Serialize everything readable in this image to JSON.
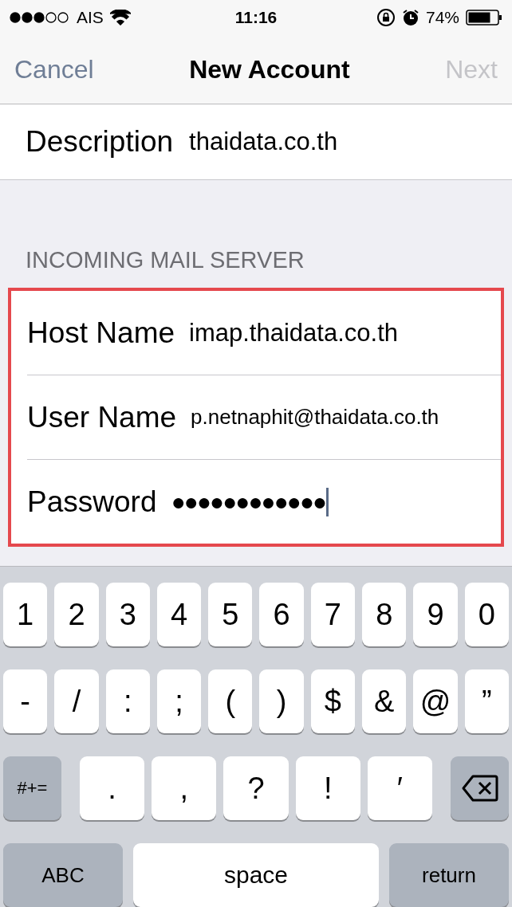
{
  "status_bar": {
    "carrier": "AIS",
    "time": "11:16",
    "battery": "74%"
  },
  "nav": {
    "cancel": "Cancel",
    "title": "New Account",
    "next": {
      "label": "Next",
      "disabled": true
    }
  },
  "description": {
    "label": "Description",
    "value": "thaidata.co.th"
  },
  "incoming": {
    "header": "INCOMING MAIL SERVER",
    "highlighted": true,
    "fields": [
      {
        "label": "Host Name",
        "value": "imap.thaidata.co.th",
        "kind": "text"
      },
      {
        "label": "User Name",
        "value": "p.netnaphit@thaidata.co.th",
        "kind": "text"
      },
      {
        "label": "Password",
        "value": "●●●●●●●●●●●●",
        "kind": "password"
      }
    ]
  },
  "keyboard": {
    "rows": [
      {
        "keys": [
          {
            "kind": "char",
            "label": "1"
          },
          {
            "kind": "char",
            "label": "2"
          },
          {
            "kind": "char",
            "label": "3"
          },
          {
            "kind": "char",
            "label": "4"
          },
          {
            "kind": "char",
            "label": "5"
          },
          {
            "kind": "char",
            "label": "6"
          },
          {
            "kind": "char",
            "label": "7"
          },
          {
            "kind": "char",
            "label": "8"
          },
          {
            "kind": "char",
            "label": "9"
          },
          {
            "kind": "char",
            "label": "0"
          }
        ]
      },
      {
        "keys": [
          {
            "kind": "char",
            "label": "-"
          },
          {
            "kind": "char",
            "label": "/"
          },
          {
            "kind": "char",
            "label": ":"
          },
          {
            "kind": "char",
            "label": ";"
          },
          {
            "kind": "char",
            "label": "("
          },
          {
            "kind": "char",
            "label": ")"
          },
          {
            "kind": "char",
            "label": "$"
          },
          {
            "kind": "char",
            "label": "&"
          },
          {
            "kind": "char",
            "label": "@"
          },
          {
            "kind": "char",
            "label": "”"
          }
        ]
      },
      {
        "keys": [
          {
            "kind": "function",
            "label": "#+="
          },
          {
            "kind": "wide",
            "label": "."
          },
          {
            "kind": "wide",
            "label": ","
          },
          {
            "kind": "wide",
            "label": "?"
          },
          {
            "kind": "wide",
            "label": "!"
          },
          {
            "kind": "wide",
            "label": "′"
          },
          {
            "kind": "delete"
          }
        ]
      },
      {
        "keys": [
          {
            "kind": "function",
            "label": "ABC"
          },
          {
            "kind": "space",
            "label": "space"
          },
          {
            "kind": "function",
            "label": "return"
          }
        ]
      }
    ]
  }
}
